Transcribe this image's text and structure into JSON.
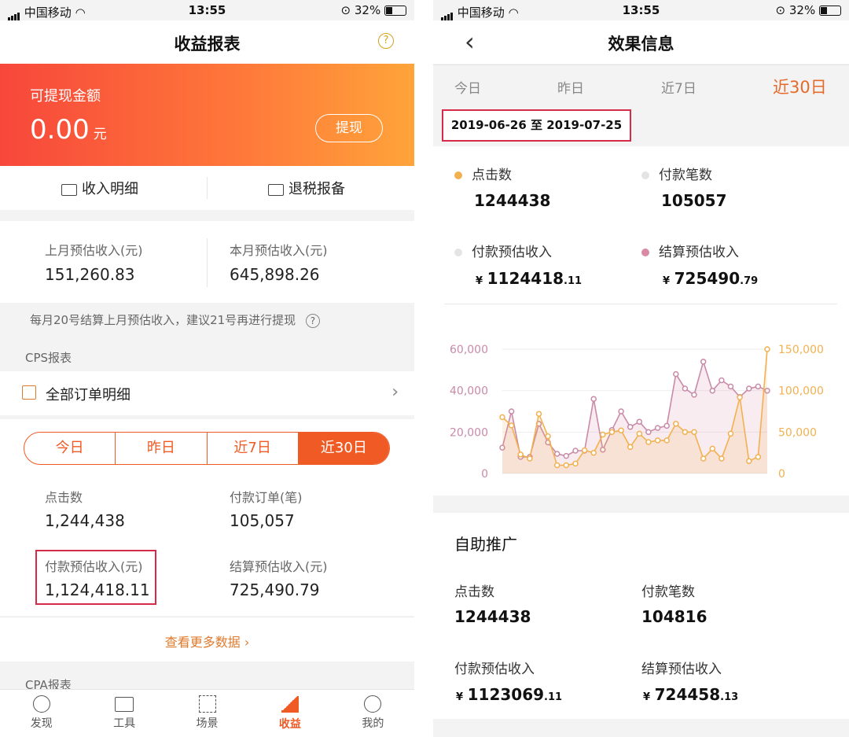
{
  "status": {
    "carrier": "中国移动",
    "time": "13:55",
    "battery": "32%"
  },
  "left": {
    "title": "收益报表",
    "help_icon": "?",
    "banner": {
      "label": "可提现金额",
      "amount": "0.00",
      "unit": "元",
      "withdraw": "提现",
      "color_start": "#f7473b",
      "color_end": "#ffa43a"
    },
    "actions": [
      {
        "label": "收入明细",
        "icon": "wallet-icon"
      },
      {
        "label": "退税报备",
        "icon": "envelope-icon"
      }
    ],
    "summary": [
      {
        "label": "上月预估收入(元)",
        "value": "151,260.83"
      },
      {
        "label": "本月预估收入(元)",
        "value": "645,898.26"
      }
    ],
    "note": "每月20号结算上月预估收入，建议21号再进行提现",
    "cps_header": "CPS报表",
    "orders_row": "全部订单明细",
    "segments": [
      "今日",
      "昨日",
      "近7日",
      "近30日"
    ],
    "active_segment": "近30日",
    "stats": [
      {
        "label": "点击数",
        "value": "1,244,438"
      },
      {
        "label": "付款订单(笔)",
        "value": "105,057"
      },
      {
        "label": "付款预估收入(元)",
        "value": "1,124,418.11"
      },
      {
        "label": "结算预估收入(元)",
        "value": "725,490.79"
      }
    ],
    "more": "查看更多数据",
    "cpa_header": "CPA报表",
    "tabs": [
      {
        "label": "发现",
        "icon": "discover-icon"
      },
      {
        "label": "工具",
        "icon": "toolbox-icon"
      },
      {
        "label": "场景",
        "icon": "scene-icon"
      },
      {
        "label": "收益",
        "icon": "earnings-icon"
      },
      {
        "label": "我的",
        "icon": "profile-icon"
      }
    ],
    "active_tab": "收益",
    "accent": "#f05a24"
  },
  "right": {
    "title": "效果信息",
    "back_icon": "chevron-left-icon",
    "tabs": [
      "今日",
      "昨日",
      "近7日",
      "近30日"
    ],
    "active_tab": "近30日",
    "date_range": "2019-06-26 至 2019-07-25",
    "metrics": [
      {
        "label": "点击数",
        "value": "1244438",
        "color": "#f2b150"
      },
      {
        "label": "付款笔数",
        "value": "105057",
        "color": "#e4e4e4"
      },
      {
        "label": "付款预估收入",
        "currency": "¥",
        "int": "1124418",
        "dec": ".11",
        "color": "#e4e4e4"
      },
      {
        "label": "结算预估收入",
        "currency": "¥",
        "int": "725490",
        "dec": ".79",
        "color": "#d98aa4"
      }
    ],
    "section2": {
      "title": "自助推广",
      "metrics": [
        {
          "label": "点击数",
          "value": "1244438"
        },
        {
          "label": "付款笔数",
          "value": "104816"
        },
        {
          "label": "付款预估收入",
          "currency": "¥",
          "int": "1123069",
          "dec": ".11"
        },
        {
          "label": "结算预估收入",
          "currency": "¥",
          "int": "724458",
          "dec": ".13"
        }
      ]
    }
  },
  "chart_data": {
    "type": "line",
    "x": [
      1,
      2,
      3,
      4,
      5,
      6,
      7,
      8,
      9,
      10,
      11,
      12,
      13,
      14,
      15,
      16,
      17,
      18,
      19,
      20,
      21,
      22,
      23,
      24,
      25,
      26,
      27,
      28,
      29,
      30
    ],
    "y_left": {
      "ticks": [
        "0",
        "20,000",
        "40,000",
        "60,000"
      ],
      "range": [
        0,
        60000
      ]
    },
    "y_right": {
      "ticks": [
        "0",
        "50,000",
        "100,000",
        "150,000"
      ],
      "range": [
        0,
        150000
      ]
    },
    "series": [
      {
        "axis": "left",
        "color": "#c98aa8",
        "values": [
          12500,
          30000,
          8000,
          8000,
          24000,
          15000,
          9500,
          8500,
          11000,
          11000,
          36000,
          11500,
          21000,
          30000,
          22500,
          25000,
          20000,
          22000,
          23000,
          48000,
          41000,
          38000,
          54000,
          40000,
          45000,
          42000,
          37000,
          41000,
          42000,
          40000
        ]
      },
      {
        "axis": "right",
        "color": "#f2b150",
        "values": [
          68000,
          58000,
          23000,
          18000,
          72000,
          45000,
          10000,
          10000,
          12000,
          28000,
          25000,
          47000,
          50000,
          52000,
          32000,
          48000,
          38000,
          40000,
          40000,
          60000,
          50000,
          50000,
          18000,
          30000,
          18000,
          48000,
          92000,
          15000,
          20000,
          150000
        ]
      }
    ]
  }
}
